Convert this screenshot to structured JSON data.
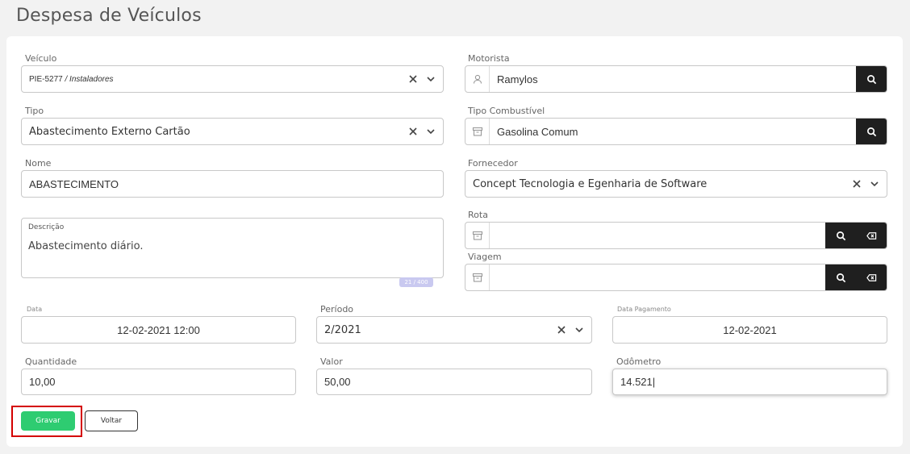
{
  "page": {
    "title": "Despesa de Veículos"
  },
  "form": {
    "veiculo": {
      "label": "Veículo",
      "plate": "PIE-5277",
      "group": "/ Instaladores"
    },
    "motorista": {
      "label": "Motorista",
      "value": "Ramylos"
    },
    "tipo": {
      "label": "Tipo",
      "value": "Abastecimento Externo Cartão"
    },
    "tipo_combustivel": {
      "label": "Tipo Combustível",
      "value": "Gasolina Comum"
    },
    "nome": {
      "label": "Nome",
      "value": "ABASTECIMENTO"
    },
    "fornecedor": {
      "label": "Fornecedor",
      "value": "Concept Tecnologia e Egenharia de Software"
    },
    "descricao": {
      "label": "Descrição",
      "value": "Abastecimento diário.",
      "counter": "21 / 400"
    },
    "rota": {
      "label": "Rota",
      "value": ""
    },
    "viagem": {
      "label": "Viagem",
      "value": ""
    },
    "data": {
      "label": "Data",
      "value": "12-02-2021 12:00"
    },
    "periodo": {
      "label": "Período",
      "value": "2/2021"
    },
    "data_pagamento": {
      "label": "Data Pagamento",
      "value": "12-02-2021"
    },
    "quantidade": {
      "label": "Quantidade",
      "value": "10,00"
    },
    "valor": {
      "label": "Valor",
      "value": "50,00"
    },
    "odometro": {
      "label": "Odômetro",
      "value": "14.521|"
    }
  },
  "actions": {
    "save_label": "Gravar",
    "back_label": "Voltar"
  },
  "colors": {
    "save": "#2ecc71",
    "highlight": "#d40000",
    "dark_button": "#1f1f1f"
  }
}
